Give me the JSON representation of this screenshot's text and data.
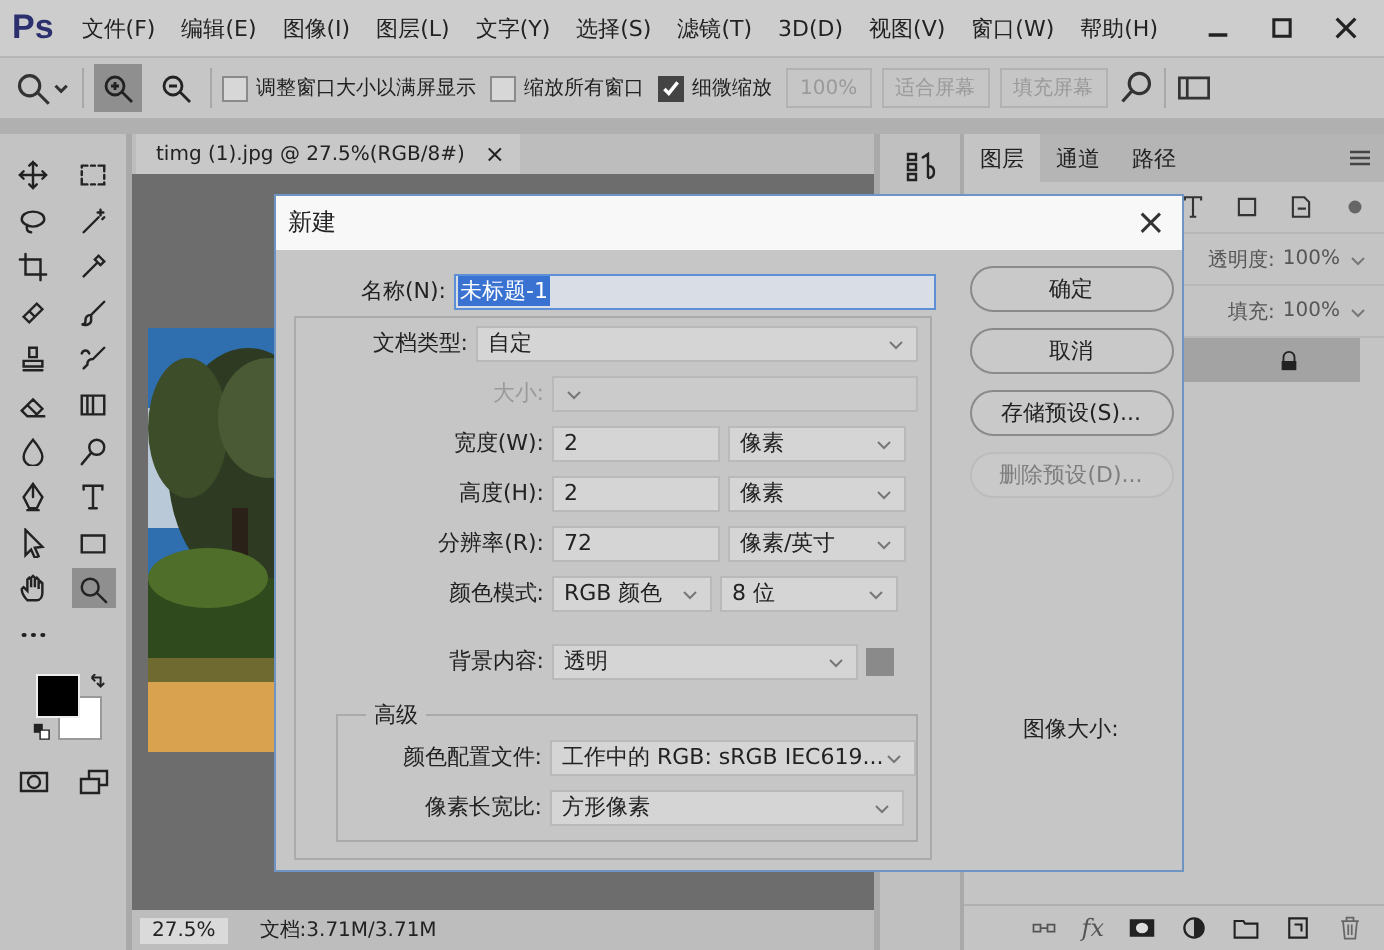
{
  "app": {
    "logo": "Ps"
  },
  "menu": [
    {
      "label": "文件(F)"
    },
    {
      "label": "编辑(E)"
    },
    {
      "label": "图像(I)"
    },
    {
      "label": "图层(L)"
    },
    {
      "label": "文字(Y)"
    },
    {
      "label": "选择(S)"
    },
    {
      "label": "滤镜(T)"
    },
    {
      "label": "3D(D)"
    },
    {
      "label": "视图(V)"
    },
    {
      "label": "窗口(W)"
    },
    {
      "label": "帮助(H)"
    }
  ],
  "options_bar": {
    "zoom_modes": [
      {
        "kind": "zoom-in",
        "selected": true
      },
      {
        "kind": "zoom-out",
        "selected": false
      }
    ],
    "checkboxes": [
      {
        "label": "调整窗口大小以满屏显示",
        "checked": false
      },
      {
        "label": "缩放所有窗口",
        "checked": false
      },
      {
        "label": "细微缩放",
        "checked": true
      }
    ],
    "buttons": [
      {
        "label": "100%",
        "disabled": true
      },
      {
        "label": "适合屏幕",
        "disabled": true
      },
      {
        "label": "填充屏幕",
        "disabled": true
      }
    ]
  },
  "tools": [
    {
      "kind": "move",
      "selected": false
    },
    {
      "kind": "marquee",
      "selected": false
    },
    {
      "kind": "lasso",
      "selected": false
    },
    {
      "kind": "wand",
      "selected": false
    },
    {
      "kind": "crop",
      "selected": false
    },
    {
      "kind": "eyedropper",
      "selected": false
    },
    {
      "kind": "healing",
      "selected": false
    },
    {
      "kind": "brush",
      "selected": false
    },
    {
      "kind": "stamp",
      "selected": false
    },
    {
      "kind": "history-brush",
      "selected": false
    },
    {
      "kind": "eraser",
      "selected": false
    },
    {
      "kind": "gradient",
      "selected": false
    },
    {
      "kind": "blur",
      "selected": false
    },
    {
      "kind": "dodge",
      "selected": false
    },
    {
      "kind": "pen",
      "selected": false
    },
    {
      "kind": "type",
      "selected": false
    },
    {
      "kind": "path-select",
      "selected": false
    },
    {
      "kind": "rectangle",
      "selected": false
    },
    {
      "kind": "hand",
      "selected": false
    },
    {
      "kind": "zoom",
      "selected": true
    },
    {
      "kind": "more",
      "selected": false
    }
  ],
  "document": {
    "tab_title": "timg (1).jpg @ 27.5%(RGB/8#)",
    "close": "×",
    "zoom": "27.5%",
    "doc_size": "文档:3.71M/3.71M"
  },
  "layers_panel": {
    "tabs": [
      {
        "label": "图层",
        "selected": true
      },
      {
        "label": "通道",
        "selected": false
      },
      {
        "label": "路径",
        "selected": false
      }
    ],
    "opacity_label": "透明度:",
    "opacity": "100%",
    "fill_label": "填充:",
    "fill": "100%",
    "fx": "fx"
  },
  "dialog": {
    "title": "新建",
    "close": "×",
    "name": {
      "label": "名称(N):",
      "value": "未标题-1",
      "highlighted": true
    },
    "fields": [
      {
        "kind": "select",
        "label": "文档类型:",
        "value": "自定",
        "disabled": false
      },
      {
        "kind": "select",
        "label": "大小:",
        "disabled": true
      },
      {
        "kind": "input-unit",
        "label": "宽度(W):",
        "value": "2",
        "unit": "像素"
      },
      {
        "kind": "input-unit",
        "label": "高度(H):",
        "value": "2",
        "unit": "像素"
      },
      {
        "kind": "input-unit",
        "label": "分辨率(R):",
        "value": "72",
        "unit": "像素/英寸"
      },
      {
        "kind": "select-pair",
        "label": "颜色模式:",
        "value": "RGB 颜色",
        "unit": "8 位"
      },
      {
        "kind": "select-swatch",
        "label": "背景内容:",
        "value": "透明",
        "color": "#8a8a8a"
      }
    ],
    "advanced": {
      "title": "高级",
      "fields": [
        {
          "label": "颜色配置文件:",
          "value": "工作中的 RGB: sRGB IEC619..."
        },
        {
          "label": "像素长宽比:",
          "value": "方形像素"
        }
      ]
    },
    "buttons": [
      {
        "label": "确定",
        "disabled": false
      },
      {
        "label": "取消",
        "disabled": false
      },
      {
        "label": "存储预设(S)...",
        "disabled": false
      },
      {
        "label": "删除预设(D)...",
        "disabled": true
      }
    ],
    "image_size_label": "图像大小:"
  }
}
